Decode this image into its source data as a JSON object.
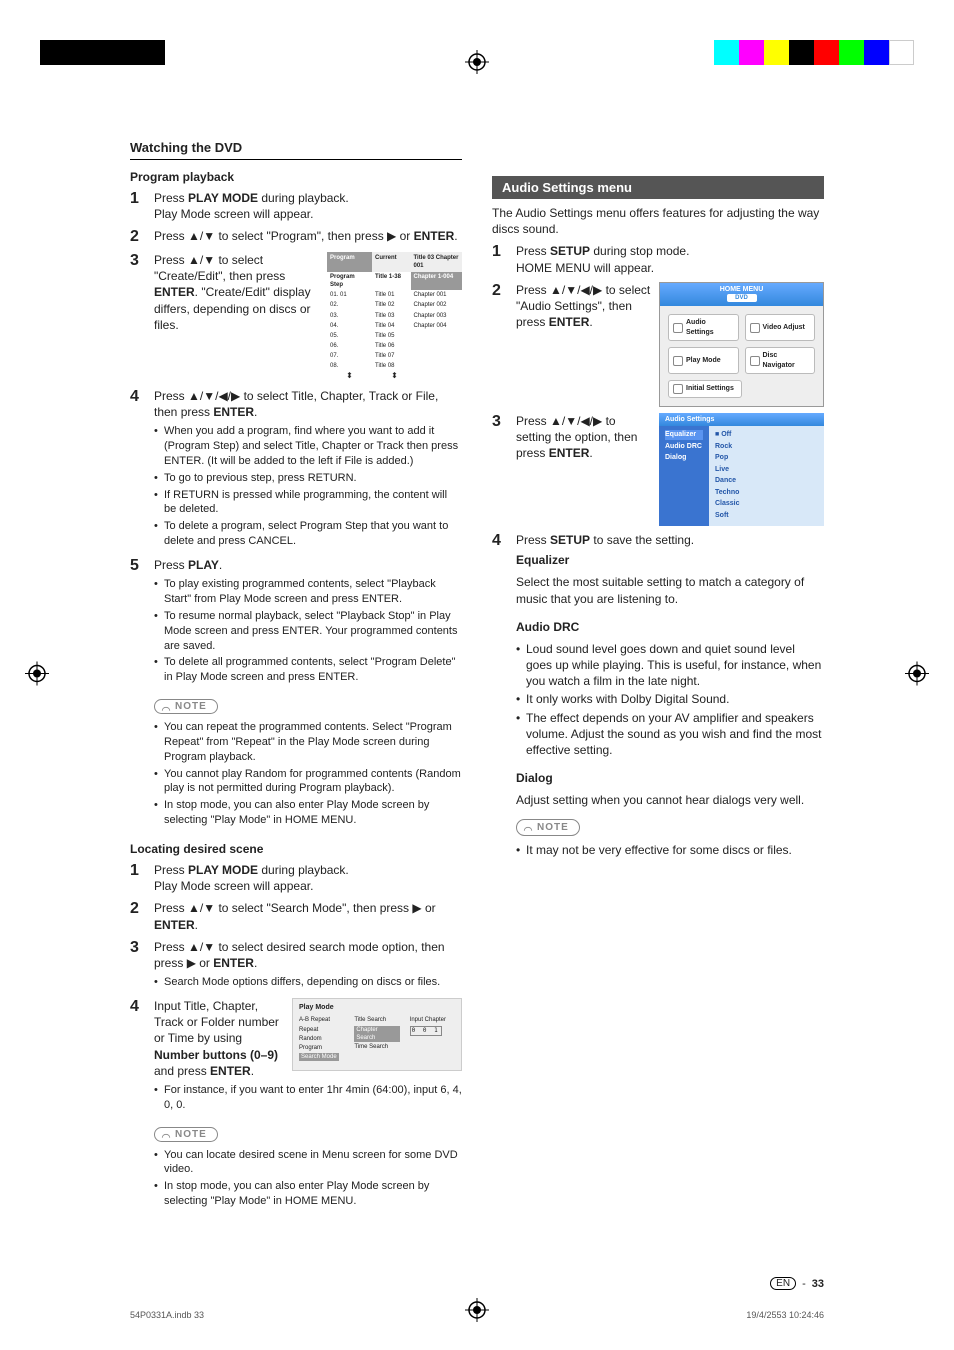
{
  "section_title": "Watching the DVD",
  "left": {
    "h1": "Program playback",
    "s1": {
      "t1": "Press ",
      "b1": "PLAY MODE",
      "t2": " during playback.",
      "t3": "Play Mode screen will appear."
    },
    "s2": {
      "t1": "Press ",
      "arrows1": "▲/▼",
      "t2": " to select \"Program\", then press ",
      "arrows2": "▶",
      "t3": " or ",
      "b1": "ENTER",
      "t4": "."
    },
    "s3": {
      "t1": "Press ",
      "arrows1": "▲/▼",
      "t2": " to select \"Create/Edit\", then press ",
      "b1": "ENTER",
      "t3": ". \"Create/Edit\" display differs, depending on discs or files."
    },
    "prog_table": {
      "h_c1": "Program",
      "h_c2": "Current",
      "h_c3": "Title 03   Chapter 001",
      "sub_c1": "Program Step",
      "sub_c2": "Title 1-38",
      "sub_c3": "Chapter 1-004",
      "rows": [
        {
          "c1": "01. 01",
          "c2": "Title 01",
          "c3": "Chapter 001"
        },
        {
          "c1": "02.",
          "c2": "Title 02",
          "c3": "Chapter 002"
        },
        {
          "c1": "03.",
          "c2": "Title 03",
          "c3": "Chapter 003"
        },
        {
          "c1": "04.",
          "c2": "Title 04",
          "c3": "Chapter 004"
        },
        {
          "c1": "05.",
          "c2": "Title 05",
          "c3": ""
        },
        {
          "c1": "06.",
          "c2": "Title 06",
          "c3": ""
        },
        {
          "c1": "07.",
          "c2": "Title 07",
          "c3": ""
        },
        {
          "c1": "08.",
          "c2": "Title 08",
          "c3": ""
        }
      ]
    },
    "s4": {
      "t1": "Press ",
      "arrows1": "▲/▼/◀/▶",
      "t2": " to select Title, Chapter, Track or File, then press ",
      "b1": "ENTER",
      "t3": ".",
      "b": [
        "When you add a program, find where you want to add it (Program Step) and select Title, Chapter or Track then press ENTER. (It will be added to the left if File is added.)",
        "To go to previous step, press RETURN.",
        "If RETURN is pressed while programming, the content will be deleted.",
        "To delete a program, select Program Step that you want to delete and press CANCEL."
      ]
    },
    "s5": {
      "t1": "Press ",
      "b1": "PLAY",
      "t2": ".",
      "b": [
        "To play existing programmed contents, select \"Playback Start\" from Play Mode screen and press ENTER.",
        "To resume normal playback, select \"Playback Stop\" in Play Mode screen and press ENTER. Your programmed contents are saved.",
        "To delete all programmed contents, select \"Program Delete\" in Play Mode screen and press ENTER."
      ]
    },
    "note_label": "NOTE",
    "note1": [
      "You can repeat the programmed contents. Select \"Program Repeat\" from \"Repeat\" in the Play Mode screen during Program playback.",
      "You cannot play Random for programmed contents (Random play is not permitted during Program playback).",
      "In stop mode, you can also enter Play Mode screen by selecting \"Play Mode\" in HOME MENU."
    ],
    "h2": "Locating desired scene",
    "s6": {
      "t1": "Press ",
      "b1": "PLAY MODE",
      "t2": " during playback.",
      "t3": "Play Mode screen will appear."
    },
    "s7": {
      "t1": "Press ",
      "arrows1": "▲/▼",
      "t2": " to select \"Search Mode\", then press ",
      "arrows2": "▶",
      "t3": " or ",
      "b1": "ENTER",
      "t4": "."
    },
    "s8": {
      "t1": "Press ",
      "arrows1": "▲/▼",
      "t2": " to select desired search mode option, then press ",
      "arrows2": "▶",
      "t3": " or ",
      "b1": "ENTER",
      "t4": ".",
      "b": [
        "Search Mode options differs, depending on discs or files."
      ]
    },
    "s9": {
      "t1": "Input Title, Chapter, Track or Folder number or Time by using ",
      "b1": "Number buttons (0–9)",
      "t2": " and press ",
      "b2": "ENTER",
      "t3": ".",
      "b": [
        "For instance, if you want to enter 1hr 4min (64:00), input 6, 4, 0, 0."
      ]
    },
    "playmode_box": {
      "title": "Play Mode",
      "col1": [
        "A-B Repeat",
        "Repeat",
        "Random",
        "Program",
        "Search Mode"
      ],
      "col2": [
        "Title Search",
        "Chapter Search",
        "Time Search"
      ],
      "col3_label": "Input Chapter",
      "col3_input": "0 0 1"
    },
    "note2": [
      "You can locate desired scene in Menu screen for some DVD video.",
      "In stop mode, you can also enter Play Mode screen by selecting \"Play Mode\" in HOME MENU."
    ]
  },
  "right": {
    "menu_title": "Audio Settings menu",
    "intro": "The Audio Settings menu offers features for adjusting the way discs sound.",
    "s1": {
      "t1": "Press ",
      "b1": "SETUP",
      "t2": " during stop mode.",
      "t3": "HOME MENU will appear."
    },
    "s2": {
      "t1": "Press ",
      "arrows1": "▲/▼/◀/▶",
      "t2": " to select \"Audio Settings\", then press ",
      "b1": "ENTER",
      "t3": "."
    },
    "home_menu": {
      "title": "HOME MENU",
      "sub": "DVD",
      "btns": [
        "Audio Settings",
        "Video Adjust",
        "Play Mode",
        "Disc Navigator",
        "Initial Settings"
      ]
    },
    "s3": {
      "t1": "Press ",
      "arrows1": "▲/▼/◀/▶",
      "t2": " to setting the option, then press ",
      "b1": "ENTER",
      "t3": "."
    },
    "audio_panel": {
      "title": "Audio Settings",
      "left": [
        "Equalizer",
        "Audio DRC",
        "Dialog"
      ],
      "right": [
        "Off",
        "Rock",
        "Pop",
        "Live",
        "Dance",
        "Techno",
        "Classic",
        "Soft"
      ],
      "right_marker": "■"
    },
    "s4": {
      "t1": "Press ",
      "b1": "SETUP",
      "t2": " to save the setting."
    },
    "eq_h": "Equalizer",
    "eq_body": "Select the most suitable setting to match a category of music that you are listening to.",
    "drc_h": "Audio DRC",
    "drc_b": [
      "Loud sound level goes down and quiet sound level goes up while playing. This is useful, for instance, when you watch a film in the late night.",
      "It only works with Dolby Digital Sound.",
      "The effect depends on your AV amplifier and speakers volume. Adjust the sound as you wish and find the most effective setting."
    ],
    "dialog_h": "Dialog",
    "dialog_body": "Adjust setting when you cannot hear dialogs very well.",
    "note": [
      "It may not be very effective for some discs or files."
    ]
  },
  "footer": {
    "en": "EN",
    "dash": "-",
    "page": "33",
    "left": "54P0331A.indb   33",
    "right": "19/4/2553   10:24:46"
  },
  "printer_colors_left": [
    "#000",
    "#000",
    "#000",
    "#000",
    "#000"
  ],
  "printer_colors_right": [
    "#0ff",
    "#f0f",
    "#ff0",
    "#000",
    "#f00",
    "#0f0",
    "#00f",
    "#fff"
  ]
}
